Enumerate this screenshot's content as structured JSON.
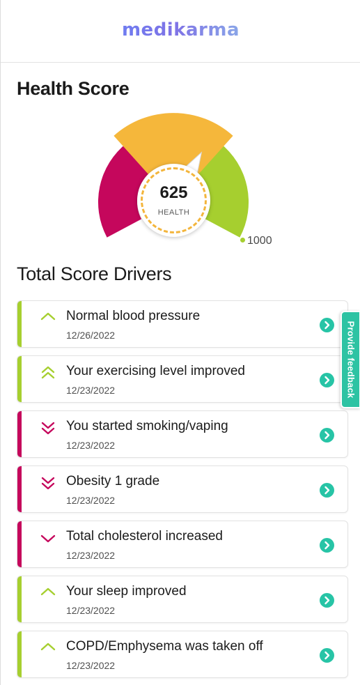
{
  "app": {
    "brand": "medikarma"
  },
  "health_score": {
    "title": "Health Score",
    "score": "625",
    "score_label": "HEALTH",
    "max_label": "1000",
    "score_value": 625,
    "score_max": 1000,
    "gauge_colors": {
      "low": "#c5075c",
      "mid": "#f5b73b",
      "high": "#a6cf2f",
      "dash": "#f3b53c"
    }
  },
  "drivers": {
    "title": "Total Score Drivers",
    "items": [
      {
        "title": "Normal blood pressure",
        "date": "12/26/2022",
        "direction": "up",
        "strength": "single",
        "color": "#a6cf2f",
        "icon": "chevron-up-icon"
      },
      {
        "title": "Your exercising level improved",
        "date": "12/23/2022",
        "direction": "up",
        "strength": "double",
        "color": "#a6cf2f",
        "icon": "double-chevron-up-icon"
      },
      {
        "title": "You started smoking/vaping",
        "date": "12/23/2022",
        "direction": "down",
        "strength": "double",
        "color": "#c5075c",
        "icon": "double-chevron-down-icon"
      },
      {
        "title": "Obesity 1 grade",
        "date": "12/23/2022",
        "direction": "down",
        "strength": "double",
        "color": "#c5075c",
        "icon": "double-chevron-down-icon"
      },
      {
        "title": "Total cholesterol increased",
        "date": "12/23/2022",
        "direction": "down",
        "strength": "single",
        "color": "#c5075c",
        "icon": "chevron-down-icon"
      },
      {
        "title": "Your sleep improved",
        "date": "12/23/2022",
        "direction": "up",
        "strength": "single",
        "color": "#a6cf2f",
        "icon": "chevron-up-icon"
      },
      {
        "title": "COPD/Emphysema was taken off",
        "date": "12/23/2022",
        "direction": "up",
        "strength": "single",
        "color": "#a6cf2f",
        "icon": "chevron-up-icon"
      }
    ]
  },
  "feedback": {
    "label": "Provide feedback",
    "color": "#2dc3a3"
  },
  "accent": {
    "go_button": "#27c4a6"
  }
}
